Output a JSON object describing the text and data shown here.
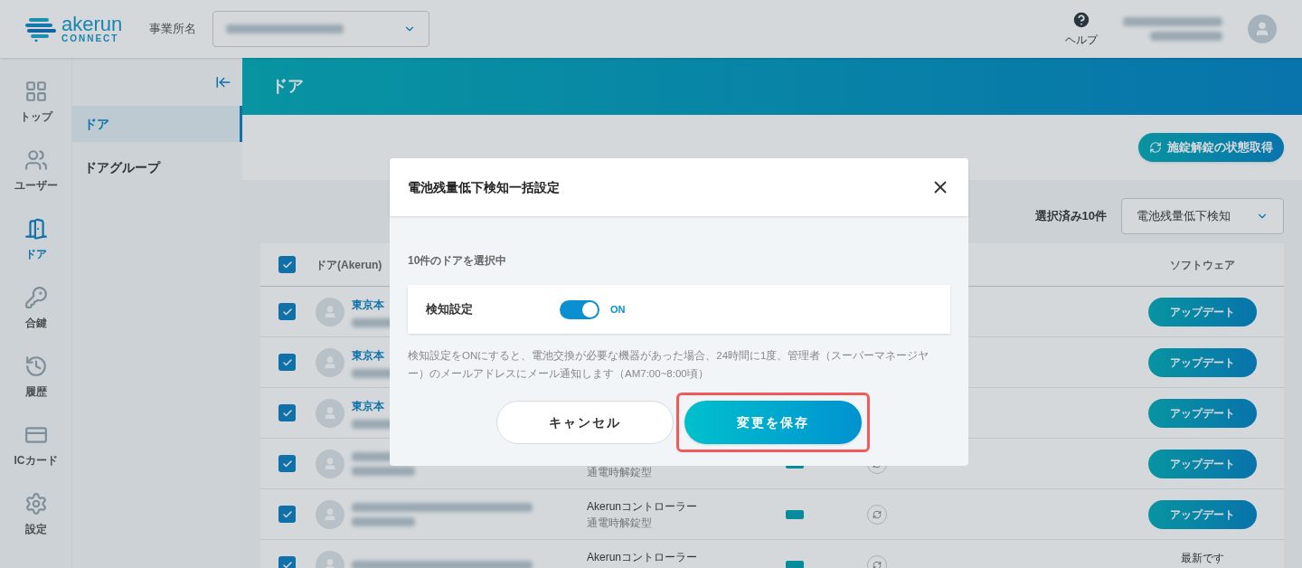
{
  "header": {
    "logo": {
      "word": "akerun",
      "sub": "CONNECT"
    },
    "office_label": "事業所名",
    "help": "ヘルプ"
  },
  "rail": {
    "items": [
      {
        "kind": "top",
        "label": "トップ",
        "selected": false
      },
      {
        "kind": "users",
        "label": "ユーザー",
        "selected": false
      },
      {
        "kind": "door",
        "label": "ドア",
        "selected": true
      },
      {
        "kind": "key",
        "label": "合鍵",
        "selected": false
      },
      {
        "kind": "history",
        "label": "履歴",
        "selected": false
      },
      {
        "kind": "card",
        "label": "ICカード",
        "selected": false
      },
      {
        "kind": "settings",
        "label": "設定",
        "selected": false
      }
    ]
  },
  "subnav": {
    "items": [
      {
        "label": "ドア",
        "selected": true
      },
      {
        "label": "ドアグループ",
        "selected": false
      }
    ]
  },
  "banner": {
    "title": "ドア"
  },
  "toolbar": {
    "fetch_button": "施錠解錠の状態取得",
    "selection_count": "選択済み10件",
    "action_select": "電池残量低下検知"
  },
  "table": {
    "header_checked": true,
    "columns": [
      "ドア(Akerun)",
      "ソフトウェア"
    ],
    "rows": [
      {
        "checked": true,
        "name": "東京本",
        "software": {
          "kind": "button",
          "label": "アップデート"
        }
      },
      {
        "checked": true,
        "name": "東京本",
        "software": {
          "kind": "button",
          "label": "アップデート"
        }
      },
      {
        "checked": true,
        "name": "東京本",
        "software": {
          "kind": "button",
          "label": "アップデート"
        }
      },
      {
        "checked": true,
        "mode": "通電時解錠型",
        "battery": true,
        "software": {
          "kind": "button",
          "label": "アップデート"
        }
      },
      {
        "checked": true,
        "type": "Akerunコントローラー",
        "mode": "通電時解錠型",
        "battery": true,
        "software": {
          "kind": "button",
          "label": "アップデート"
        }
      },
      {
        "checked": true,
        "type": "Akerunコントローラー",
        "battery": true,
        "software": {
          "kind": "text",
          "label": "最新です"
        }
      }
    ]
  },
  "modal": {
    "title": "電池残量低下検知一括設定",
    "selected_note": "10件のドアを選択中",
    "setting": {
      "label": "検知設定",
      "on": true,
      "state_label": "ON"
    },
    "description": "検知設定をONにすると、電池交換が必要な機器があった場合、24時間に1度、管理者（スーパーマネージヤー）のメールアドレスにメール通知します（AM7:00~8:00頃）",
    "cancel": "キャンセル",
    "save": "変更を保存",
    "save_highlighted": true
  }
}
